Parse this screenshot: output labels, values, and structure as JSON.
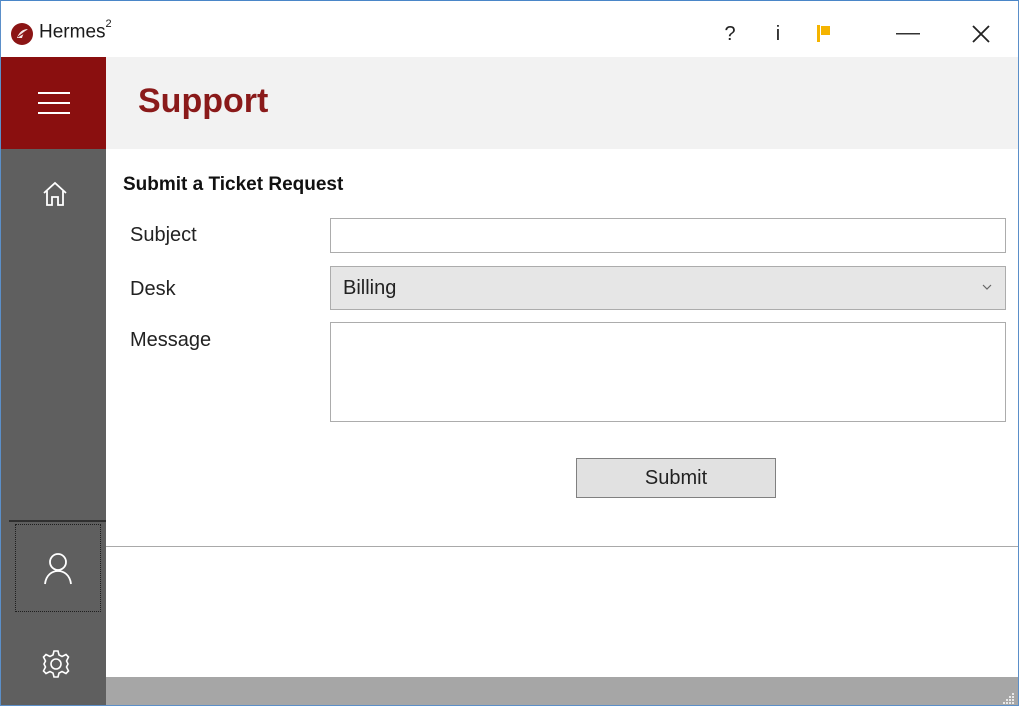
{
  "window": {
    "title": "Hermes",
    "title_superscript": "2",
    "buttons": {
      "help": "?",
      "info": "i",
      "minimize": "—",
      "close": "✕"
    }
  },
  "header": {
    "title": "Support"
  },
  "form": {
    "section_title": "Submit a Ticket Request",
    "subject_label": "Subject",
    "subject_value": "",
    "desk_label": "Desk",
    "desk_value": "Billing",
    "message_label": "Message",
    "message_value": "",
    "submit_label": "Submit"
  },
  "icons": {
    "app": "hermes-logo-icon",
    "menu": "hamburger-icon",
    "home": "home-icon",
    "user": "user-icon",
    "settings": "gear-icon",
    "flag": "flag-icon",
    "dropdown": "chevron-down-icon",
    "resize": "resize-grip-icon"
  },
  "colors": {
    "accent": "#8a0f0f",
    "title_text": "#8a1a1a",
    "sidebar": "#5f5f5f",
    "flag": "#f5b400",
    "statusbar": "#a6a6a6"
  }
}
